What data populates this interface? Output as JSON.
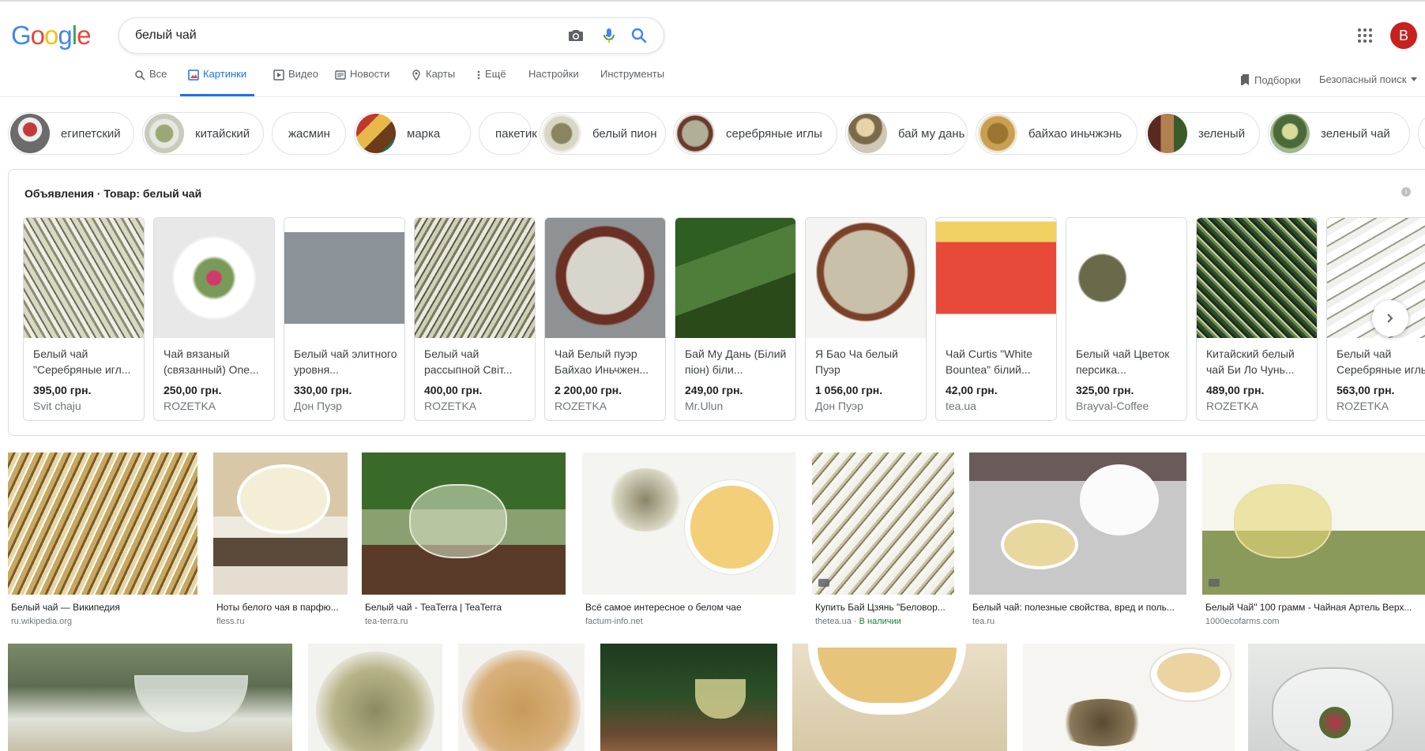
{
  "logo": {
    "letters": [
      "G",
      "o",
      "o",
      "g",
      "l",
      "e"
    ],
    "colors": [
      "#4285f4",
      "#ea4335",
      "#fbbc05",
      "#4285f4",
      "#34a853",
      "#ea4335"
    ]
  },
  "search": {
    "query": "белый чай"
  },
  "user": {
    "initial": "B",
    "color": "#c5221f"
  },
  "nav": {
    "tabs": [
      {
        "label": "Все",
        "icon": "search-icon"
      },
      {
        "label": "Картинки",
        "icon": "image-icon",
        "active": true
      },
      {
        "label": "Видео",
        "icon": "video-icon"
      },
      {
        "label": "Новости",
        "icon": "news-icon"
      },
      {
        "label": "Карты",
        "icon": "map-pin-icon"
      },
      {
        "label": "Ещё",
        "icon": "more-vert-icon"
      },
      {
        "label": "Настройки"
      },
      {
        "label": "Инструменты"
      }
    ],
    "collections": "Подборки",
    "safe_search": "Безопасный поиск"
  },
  "chips": [
    {
      "label": "египетский",
      "thumb": true
    },
    {
      "label": "китайский",
      "thumb": true
    },
    {
      "label": "жасмин",
      "thumb": false
    },
    {
      "label": "марка",
      "thumb": true
    },
    {
      "label": "пакетик",
      "thumb": false
    },
    {
      "label": "белый пион",
      "thumb": true
    },
    {
      "label": "серебряные иглы",
      "thumb": true
    },
    {
      "label": "бай му дань",
      "thumb": true
    },
    {
      "label": "байхао иньчжэнь",
      "thumb": true
    },
    {
      "label": "зеленый",
      "thumb": true
    },
    {
      "label": "зеленый чай",
      "thumb": true
    }
  ],
  "ads": {
    "prefix": "Объявления",
    "separator": " · ",
    "title": "Товар: белый чай",
    "products": [
      {
        "name": "Белый чай \"Серебряные игл...",
        "price": "395,00 грн.",
        "shop": "Svit chaju"
      },
      {
        "name": "Чай вязаный (связанный) One...",
        "price": "250,00 грн.",
        "shop": "ROZETKA"
      },
      {
        "name": "Белый чай элитного уровня...",
        "price": "330,00 грн.",
        "shop": "Дон Пуэр"
      },
      {
        "name": "Белый чай рассыпной Світ...",
        "price": "400,00 грн.",
        "shop": "ROZETKA"
      },
      {
        "name": "Чай Белый пуэр Байхао Иньчжен...",
        "price": "2 200,00 грн.",
        "shop": "ROZETKA"
      },
      {
        "name": "Бай Му Дань (Білий піон) біли...",
        "price": "249,00 грн.",
        "shop": "Mr.Ulun"
      },
      {
        "name": "Я Бао Ча белый Пуэр",
        "price": "1 056,00 грн.",
        "shop": "Дон Пуэр"
      },
      {
        "name": "Чай Curtis \"White Bountea\" білий...",
        "price": "42,00 грн.",
        "shop": "tea.ua"
      },
      {
        "name": "Белый чай Цветок персика...",
        "price": "325,00 грн.",
        "shop": "Brayval-Coffee"
      },
      {
        "name": "Китайский белый чай Би Ло Чунь...",
        "price": "489,00 грн.",
        "shop": "ROZETKA"
      },
      {
        "name": "Белый чай Серебряные иглы",
        "price": "563,00 грн.",
        "shop": "ROZETKA"
      }
    ]
  },
  "images_row1": [
    {
      "title": "Белый чай — Википедия",
      "source": "ru.wikipedia.org"
    },
    {
      "title": "Ноты белого чая в парфю...",
      "source": "fless.ru"
    },
    {
      "title": "Белый чай - TeaTerra | TeaTerra",
      "source": "tea-terra.ru"
    },
    {
      "title": "Всё самое интересное о белом чае",
      "source": "factum-info.net"
    },
    {
      "title": "Купить Бай Цзянь \"Беловор...",
      "source": "thetea.ua",
      "availability": " · В наличии"
    },
    {
      "title": "Белый чай: полезные свойства, вред и поль...",
      "source": "tea.ru"
    },
    {
      "title": "Белый Чай\" 100 грамм - Чайная Артель Верх...",
      "source": "1000ecofarms.com"
    }
  ]
}
